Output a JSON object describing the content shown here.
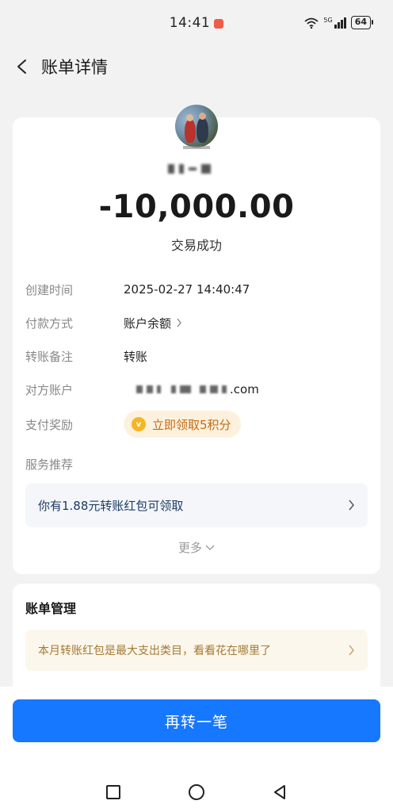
{
  "status_bar": {
    "time": "14:41",
    "signal_label": "5G",
    "battery": "64"
  },
  "header": {
    "title": "账单详情"
  },
  "transaction": {
    "amount": "-10,000.00",
    "status": "交易成功"
  },
  "details": {
    "created_label": "创建时间",
    "created_value": "2025-02-27 14:40:47",
    "payment_label": "付款方式",
    "payment_value": "账户余额",
    "note_label": "转账备注",
    "note_value": "转账",
    "account_label": "对方账户",
    "account_suffix": ".com",
    "reward_label": "支付奖励",
    "reward_value": "立即领取5积分"
  },
  "service": {
    "label": "服务推荐",
    "banner_text": "你有1.88元转账红包可领取",
    "more_label": "更多"
  },
  "bill_management": {
    "title": "账单管理",
    "banner_text": "本月转账红包是最大支出类目，看看花在哪里了"
  },
  "actions": {
    "primary_label": "再转一笔"
  },
  "colors": {
    "primary": "#1677ff",
    "reward_text": "#c46b12",
    "reward_bg": "#fdf1de",
    "bill_banner_text": "#a37a35"
  }
}
